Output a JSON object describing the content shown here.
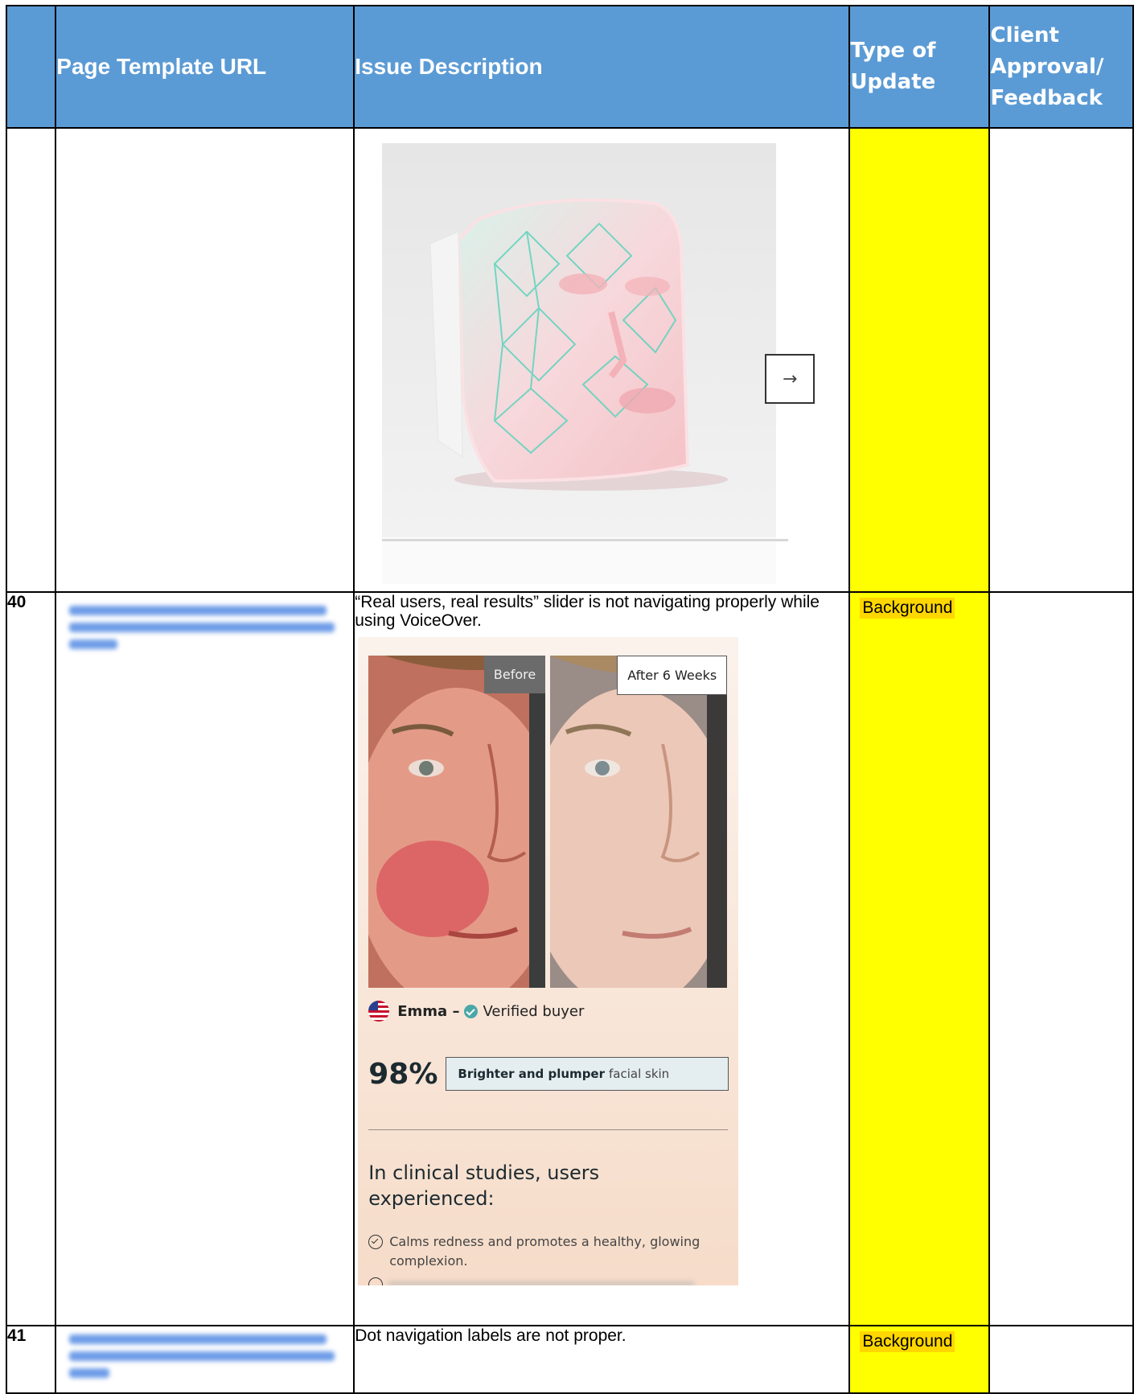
{
  "headers": {
    "num": "",
    "url": "Page Template URL",
    "desc": "Issue Description",
    "type": "Type of Update",
    "client": "Client Approval/ Feedback"
  },
  "colors": {
    "header_bg": "#5b9bd5",
    "type_cell_bg": "#ffff00",
    "badge_bg": "#ffd700",
    "url_link_blurred": "#3d7be0"
  },
  "rows": [
    {
      "num": "",
      "url": "",
      "image": {
        "kind": "product-photo",
        "subject": "led-face-mask",
        "button_icon": "right-arrow-icon",
        "button_glyph": "→"
      },
      "type": "",
      "client": ""
    },
    {
      "num": "40",
      "url_blurred": true,
      "desc": "“Real users, real results” slider is not navigating properly while using VoiceOver.",
      "type": "Background",
      "client": "",
      "slide": {
        "before_label": "Before",
        "after_label": "After 6 Weeks",
        "buyer_name": "Emma –",
        "buyer_status": "Verified buyer",
        "stat_value": "98%",
        "stat_bold": "Brighter and plumper",
        "stat_rest": "facial skin",
        "clinical_heading": "In clinical studies, users experienced:",
        "benefit_1": "Calms redness and promotes a healthy, glowing complexion."
      }
    },
    {
      "num": "41",
      "url_blurred": true,
      "desc": "Dot navigation labels are not proper.",
      "type": "Background",
      "client": ""
    }
  ]
}
